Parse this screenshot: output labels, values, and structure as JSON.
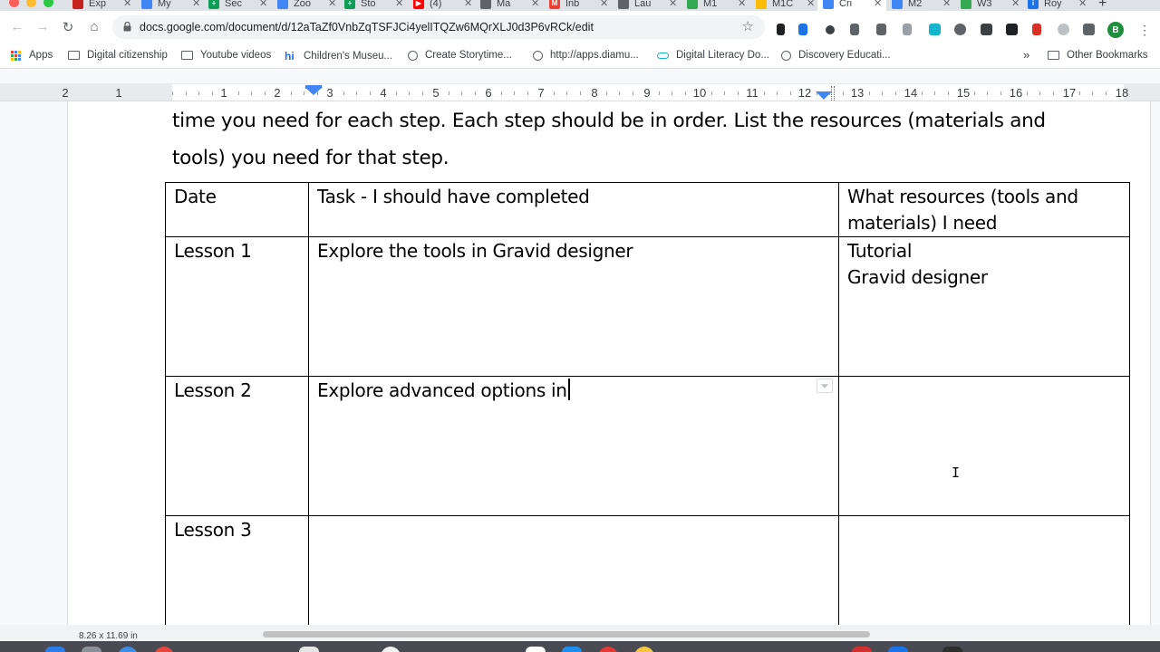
{
  "browser": {
    "tabs": [
      {
        "title": "Exp",
        "color": "#c5221f",
        "glyph": "",
        "active": false
      },
      {
        "title": "My",
        "color": "#4285f4",
        "glyph": "",
        "active": false
      },
      {
        "title": "Sec",
        "color": "#0f9d58",
        "glyph": "+",
        "active": false
      },
      {
        "title": "Zoo",
        "color": "#4285f4",
        "glyph": "",
        "active": false
      },
      {
        "title": "Sto",
        "color": "#0f9d58",
        "glyph": "+",
        "active": false
      },
      {
        "title": "(4)",
        "color": "#ff0000",
        "glyph": "▶",
        "active": false
      },
      {
        "title": "Ma",
        "color": "#5f6368",
        "glyph": "",
        "active": false
      },
      {
        "title": "Inb",
        "color": "#ea4335",
        "glyph": "M",
        "active": false
      },
      {
        "title": "Lau",
        "color": "#5f6368",
        "glyph": "",
        "active": false
      },
      {
        "title": "M1",
        "color": "#34a853",
        "glyph": "",
        "active": false
      },
      {
        "title": "M1C",
        "color": "#fbbc04",
        "glyph": "",
        "active": false
      },
      {
        "title": "Cri",
        "color": "#4285f4",
        "glyph": "",
        "active": true
      },
      {
        "title": "M2",
        "color": "#4285f4",
        "glyph": "",
        "active": false
      },
      {
        "title": "W3",
        "color": "#34a853",
        "glyph": "",
        "active": false
      },
      {
        "title": "Roy",
        "color": "#1a73e8",
        "glyph": "i",
        "active": false
      }
    ],
    "new_tab": "+",
    "url": "docs.google.com/document/d/12aTaZf0VnbZqTSFJCi4yelITQZw6MQrXLJ0d3P6vRCk/edit",
    "profile_initial": "B"
  },
  "bookmarks": [
    {
      "label": "Apps",
      "icon": "apps-grid"
    },
    {
      "label": "Digital citizenship",
      "icon": "folder"
    },
    {
      "label": "Youtube videos",
      "icon": "folder"
    },
    {
      "label": "Children's Museu...",
      "icon": "hi"
    },
    {
      "label": "Create Storytime...",
      "icon": "globe"
    },
    {
      "label": "http://apps.diamu...",
      "icon": "globe"
    },
    {
      "label": "Digital Literacy Do...",
      "icon": "link"
    },
    {
      "label": "Discovery Educati...",
      "icon": "globe"
    }
  ],
  "bookmarks_overflow": "»",
  "other_bookmarks": "Other Bookmarks",
  "ruler": {
    "labels": [
      "2",
      "1",
      "1",
      "2",
      "3",
      "4",
      "5",
      "6",
      "7",
      "8",
      "9",
      "10",
      "11",
      "12",
      "13",
      "14",
      "15",
      "16",
      "17",
      "18"
    ]
  },
  "document": {
    "intro_line1": "time you need for each step. Each step should be in order. List the resources (materials and",
    "intro_line2": "tools) you need for that step.",
    "table": {
      "headers": [
        "Date",
        "Task - I should have completed",
        "What resources (tools and materials) I need"
      ],
      "rows": [
        {
          "date": "Lesson 1",
          "task": "Explore the tools in Gravid designer",
          "resources": [
            "Tutorial",
            "Gravid designer"
          ]
        },
        {
          "date": "Lesson 2",
          "task": "Explore advanced options in",
          "resources": []
        },
        {
          "date": "Lesson 3",
          "task": "",
          "resources": []
        }
      ]
    }
  },
  "status": {
    "page_size": "8.26 x 11.69 in"
  },
  "colors": {
    "accent": "#1a73e8",
    "ruler_marker": "#4285f4"
  }
}
